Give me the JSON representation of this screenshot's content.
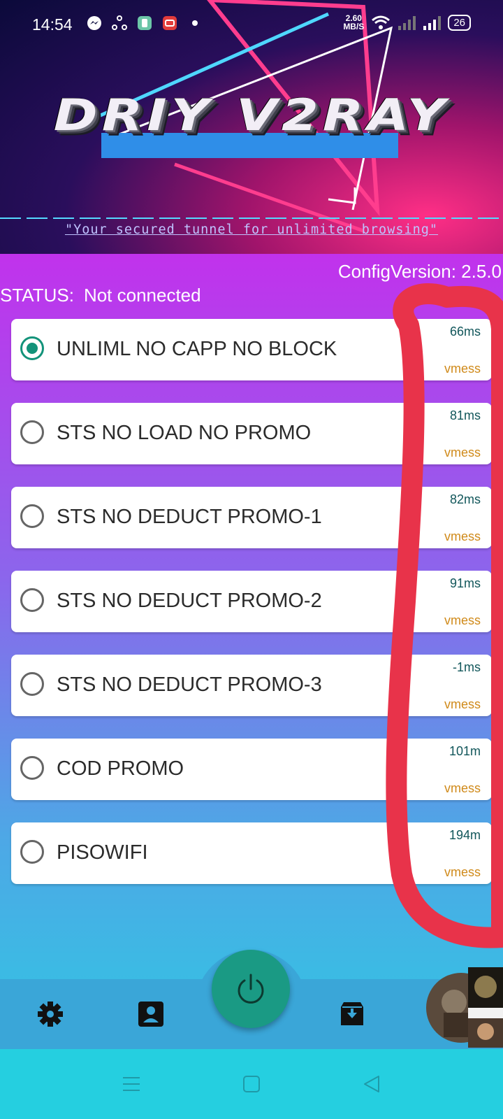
{
  "status_bar": {
    "time": "14:54",
    "net_speed_value": "2.60",
    "net_speed_unit": "MB/S",
    "battery": "26"
  },
  "banner": {
    "title": "DRIY V2RAY",
    "tagline": "\"Your secured tunnel for unlimited browsing\""
  },
  "info": {
    "config_version": "ConfigVersion: 2.5.0",
    "status_label": "STATUS:",
    "status_value": "Not connected"
  },
  "servers": [
    {
      "name": "UNLIML NO CAPP NO BLOCK",
      "ping": "66ms",
      "protocol": "vmess",
      "selected": true
    },
    {
      "name": "STS NO LOAD NO PROMO",
      "ping": "81ms",
      "protocol": "vmess",
      "selected": false
    },
    {
      "name": "STS NO DEDUCT PROMO-1",
      "ping": "82ms",
      "protocol": "vmess",
      "selected": false
    },
    {
      "name": "STS NO DEDUCT PROMO-2",
      "ping": "91ms",
      "protocol": "vmess",
      "selected": false
    },
    {
      "name": "STS NO DEDUCT PROMO-3",
      "ping": "-1ms",
      "protocol": "vmess",
      "selected": false
    },
    {
      "name": "COD PROMO",
      "ping": "101m",
      "protocol": "vmess",
      "selected": false
    },
    {
      "name": "PISOWIFI",
      "ping": "194m",
      "protocol": "vmess",
      "selected": false
    }
  ],
  "bottom_nav": {
    "icons": [
      "gear-icon",
      "contact-icon",
      "power-icon",
      "archive-download-icon"
    ]
  },
  "colors": {
    "accent": "#13937a",
    "protocol": "#d08a1a",
    "annotation": "#e8334a"
  }
}
